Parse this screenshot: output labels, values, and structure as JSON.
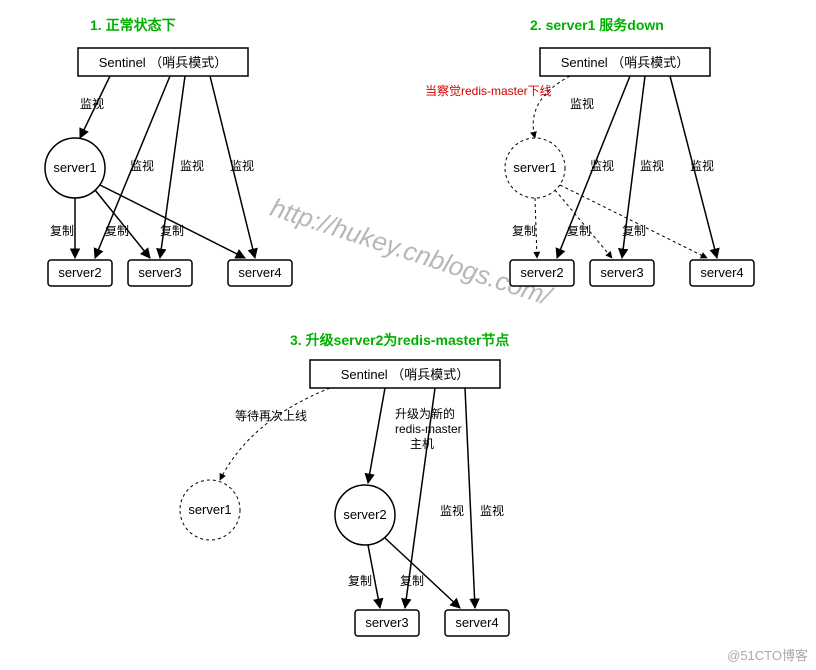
{
  "titles": {
    "t1": "1. 正常状态下",
    "t2": "2. server1 服务down",
    "t3": "3. 升级server2为redis-master节点"
  },
  "sentinel_label": "Sentinel （哨兵模式）",
  "nodes": {
    "server1": "server1",
    "server2": "server2",
    "server3": "server3",
    "server4": "server4"
  },
  "labels": {
    "monitor": "监视",
    "replicate": "复制",
    "detect_down": "当察觉redis-master下线",
    "wait_online": "等待再次上线",
    "promote_new1": "升级为新的",
    "promote_new2": "redis-master",
    "promote_new3": "主机"
  },
  "watermark": "http://hukey.cnblogs.com/",
  "corner": "@51CTO博客"
}
